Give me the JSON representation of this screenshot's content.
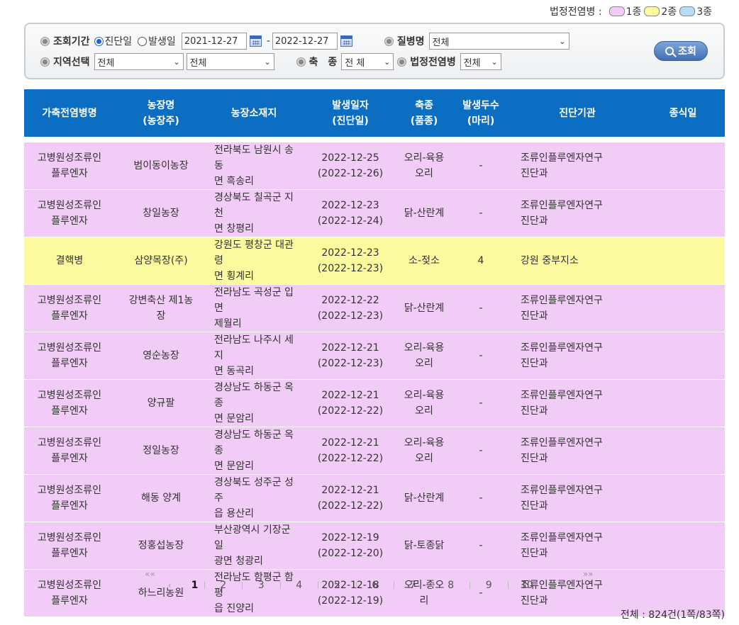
{
  "legend": {
    "title": "법정전염병 :",
    "items": [
      {
        "label": "1종",
        "color": "#f1ccf6"
      },
      {
        "label": "2종",
        "color": "#fcfa9e"
      },
      {
        "label": "3종",
        "color": "#b7dcf5"
      }
    ]
  },
  "search": {
    "period_label": "조회기간",
    "radio_diagnosis": "진단일",
    "radio_occurrence": "발생일",
    "selected_radio": "진단일",
    "date_from": "2021-12-27",
    "date_to": "2022-12-27",
    "date_dash": "-",
    "disease_label": "질병명",
    "disease_value": "전체",
    "region_label": "지역선택",
    "region1_value": "전체",
    "region2_value": "전체",
    "species_label": "축　종",
    "species_value": "전 체",
    "legal_label": "법정전염병",
    "legal_value": "전체",
    "button_label": "조회"
  },
  "table": {
    "headers": [
      "가축전염병명",
      "농장명\n(농장주)",
      "농장소재지",
      "발생일자\n(진단일)",
      "축종\n(품종)",
      "발생두수\n(마리)",
      "진단기관",
      "종식일"
    ],
    "rows": [
      {
        "kind": "pink",
        "disease": "고병원성조류인\n플루엔자",
        "farm": "범이동이농장",
        "address": "전라북도 남원시 송동\n면 흑송리",
        "date": "2022-12-25\n(2022-12-26)",
        "species": "오리-육용\n오리",
        "count": "-",
        "lab": "조류인플루엔자연구\n진단과",
        "end": ""
      },
      {
        "kind": "pink",
        "disease": "고병원성조류인\n플루엔자",
        "farm": "창일농장",
        "address": "경상북도 칠곡군 지천\n면 창평리",
        "date": "2022-12-23\n(2022-12-24)",
        "species": "닭-산란계",
        "count": "-",
        "lab": "조류인플루엔자연구\n진단과",
        "end": ""
      },
      {
        "kind": "yellow",
        "disease": "결핵병",
        "farm": "삼양목장(주)",
        "address": "강원도 평창군 대관령\n면 횡계리",
        "date": "2022-12-23\n(2022-12-23)",
        "species": "소-젖소",
        "count": "4",
        "lab": "강원 중부지소",
        "end": ""
      },
      {
        "kind": "pink",
        "disease": "고병원성조류인\n플루엔자",
        "farm": "강변축산 제1농\n장",
        "address": "전라남도 곡성군 입면\n제월리",
        "date": "2022-12-22\n(2022-12-23)",
        "species": "닭-산란계",
        "count": "-",
        "lab": "조류인플루엔자연구\n진단과",
        "end": ""
      },
      {
        "kind": "pink",
        "disease": "고병원성조류인\n플루엔자",
        "farm": "영순농장",
        "address": "전라남도 나주시 세지\n면 동곡리",
        "date": "2022-12-21\n(2022-12-23)",
        "species": "오리-육용\n오리",
        "count": "-",
        "lab": "조류인플루엔자연구\n진단과",
        "end": ""
      },
      {
        "kind": "pink",
        "disease": "고병원성조류인\n플루엔자",
        "farm": "양규팔",
        "address": "경상남도 하동군 옥종\n면 문암리",
        "date": "2022-12-21\n(2022-12-22)",
        "species": "오리-육용\n오리",
        "count": "-",
        "lab": "조류인플루엔자연구\n진단과",
        "end": ""
      },
      {
        "kind": "pink",
        "disease": "고병원성조류인\n플루엔자",
        "farm": "정일농장",
        "address": "경상남도 하동군 옥종\n면 문암리",
        "date": "2022-12-21\n(2022-12-22)",
        "species": "오리-육용\n오리",
        "count": "-",
        "lab": "조류인플루엔자연구\n진단과",
        "end": ""
      },
      {
        "kind": "pink",
        "disease": "고병원성조류인\n플루엔자",
        "farm": "해동 양계",
        "address": "경상북도 성주군 성주\n읍 용산리",
        "date": "2022-12-21\n(2022-12-22)",
        "species": "닭-산란계",
        "count": "-",
        "lab": "조류인플루엔자연구\n진단과",
        "end": ""
      },
      {
        "kind": "pink",
        "disease": "고병원성조류인\n플루엔자",
        "farm": "정홍섭농장",
        "address": "부산광역시 기장군 일\n광면 청광리",
        "date": "2022-12-19\n(2022-12-20)",
        "species": "닭-토종닭",
        "count": "-",
        "lab": "조류인플루엔자연구\n진단과",
        "end": ""
      },
      {
        "kind": "pink",
        "disease": "고병원성조류인\n플루엔자",
        "farm": "하느리농원",
        "address": "전라남도 함평군 함평\n읍 진양리",
        "date": "2022-12-18\n(2022-12-19)",
        "species": "오리-종오\n리",
        "count": "-",
        "lab": "조류인플루엔자연구\n진단과",
        "end": ""
      }
    ]
  },
  "pagination": {
    "first": "««",
    "prev": "‹",
    "next": "›",
    "last": "»»",
    "pages": [
      "1",
      "2",
      "3",
      "4",
      "5",
      "6",
      "7",
      "8",
      "9",
      "10"
    ],
    "current": "1"
  },
  "total": "전체 : 824건(1쪽/83쪽)"
}
